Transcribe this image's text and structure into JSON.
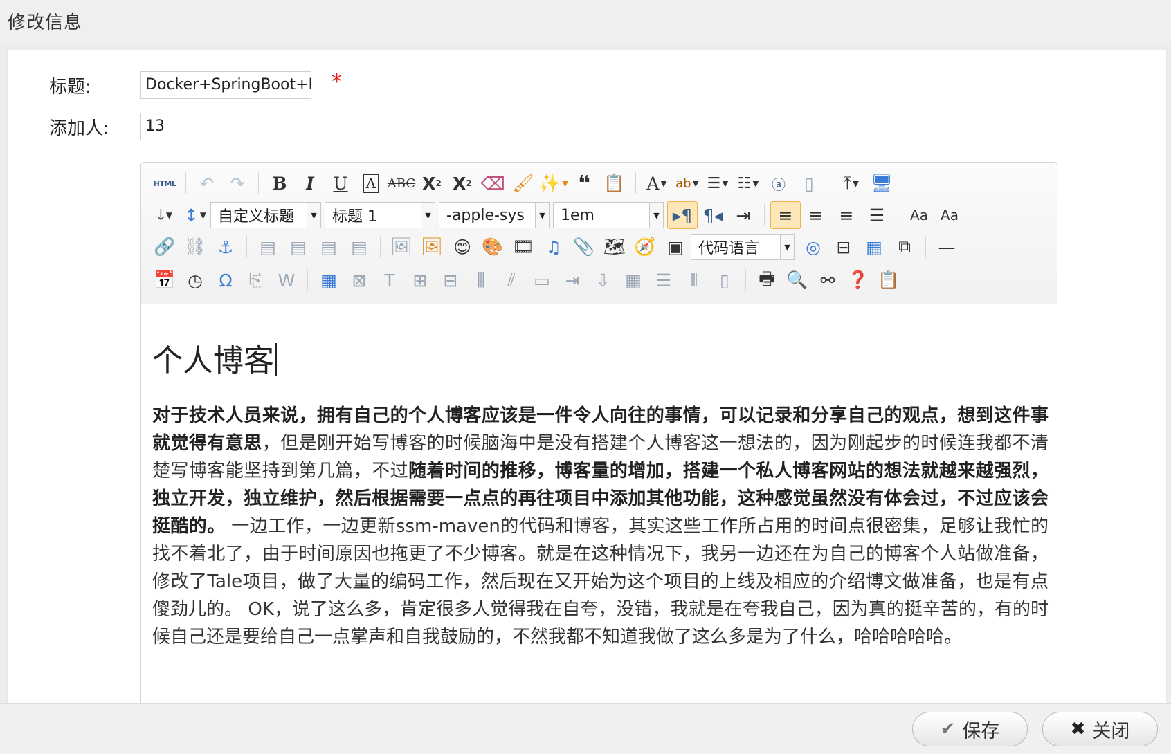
{
  "dialog": {
    "title": "修改信息"
  },
  "form": {
    "title_label": "标题:",
    "title_value": "Docker+SpringBoot+Mybatis",
    "required_mark": "*",
    "adder_label": "添加人:",
    "adder_value": "13"
  },
  "toolbar": {
    "html_label": "HTML",
    "row1": [
      "undo",
      "redo",
      "bold",
      "italic",
      "underline",
      "font-border",
      "strikethrough",
      "superscript",
      "subscript",
      "eraser",
      "format-brush",
      "auto-typeset",
      "blockquote",
      "paste-plain",
      "font-color",
      "background-color",
      "ordered-list",
      "unordered-list",
      "select-all",
      "clear-doc",
      "row-spacing-top",
      "preview"
    ],
    "paragraph_format": "自定义标题",
    "heading": "标题 1",
    "font_family": "-apple-sys",
    "font_size": "1em",
    "code_language": "代码语言"
  },
  "editor": {
    "heading": "个人博客",
    "paragraph": [
      {
        "t": "对于技术人员来说，拥有自己的个人博客应该是一件令人向往的事情，可以记录和分享自己的观点，想到这件事就觉得有意思",
        "b": true
      },
      {
        "t": "，但是刚开始写博客的时候脑海中是没有搭建个人博客这一想法的，因为刚起步的时候连我都不清楚写博客能坚持到第几篇，不过",
        "b": false
      },
      {
        "t": "随着时间的推移，博客量的增加，搭建一个私人博客网站的想法就越来越强烈，独立开发，独立维护，然后根据需要一点点的再往项目中添加其他功能，这种感觉虽然没有体会过，不过应该会挺酷的。",
        "b": true
      },
      {
        "t": " 一边工作，一边更新ssm-maven的代码和博客，其实这些工作所占用的时间点很密集，足够让我忙的找不着北了，由于时间原因也拖更了不少博客。就是在这种情况下，我另一边还在为自己的博客个人站做准备，修改了Tale项目，做了大量的编码工作，然后现在又开始为这个项目的上线及相应的介绍博文做准备，也是有点傻劲儿的。 OK，说了这么多，肯定很多人觉得我在自夸，没错，我就是在夸我自己，因为真的挺辛苦的，有的时候自己还是要给自己一点掌声和自我鼓励的，不然我都不知道我做了这么多是为了什么，哈哈哈哈哈。",
        "b": false
      }
    ]
  },
  "footer": {
    "save_label": "保存",
    "close_label": "关闭"
  }
}
